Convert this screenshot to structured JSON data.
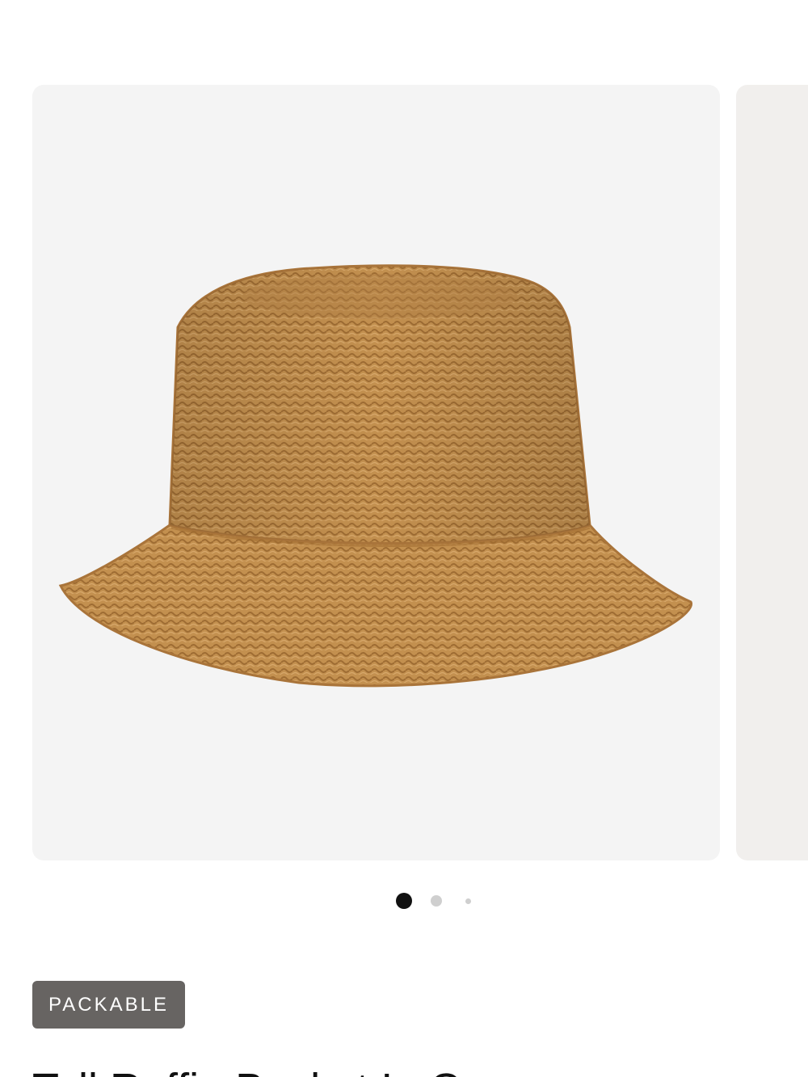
{
  "carousel": {
    "slides": [
      {
        "image": "straw-bucket-hat-photo"
      },
      {
        "image": "product-photo-partial"
      }
    ],
    "active_index": 0,
    "dot_count": 3
  },
  "product": {
    "badge": "PACKABLE",
    "title": "Tall Raffia Bucket In Cream"
  },
  "colors": {
    "image_background": "#f4f4f4",
    "badge_background": "#676462",
    "dot_active": "#111111",
    "dot_inactive": "#cfcfcf",
    "straw": "#c8955a"
  }
}
